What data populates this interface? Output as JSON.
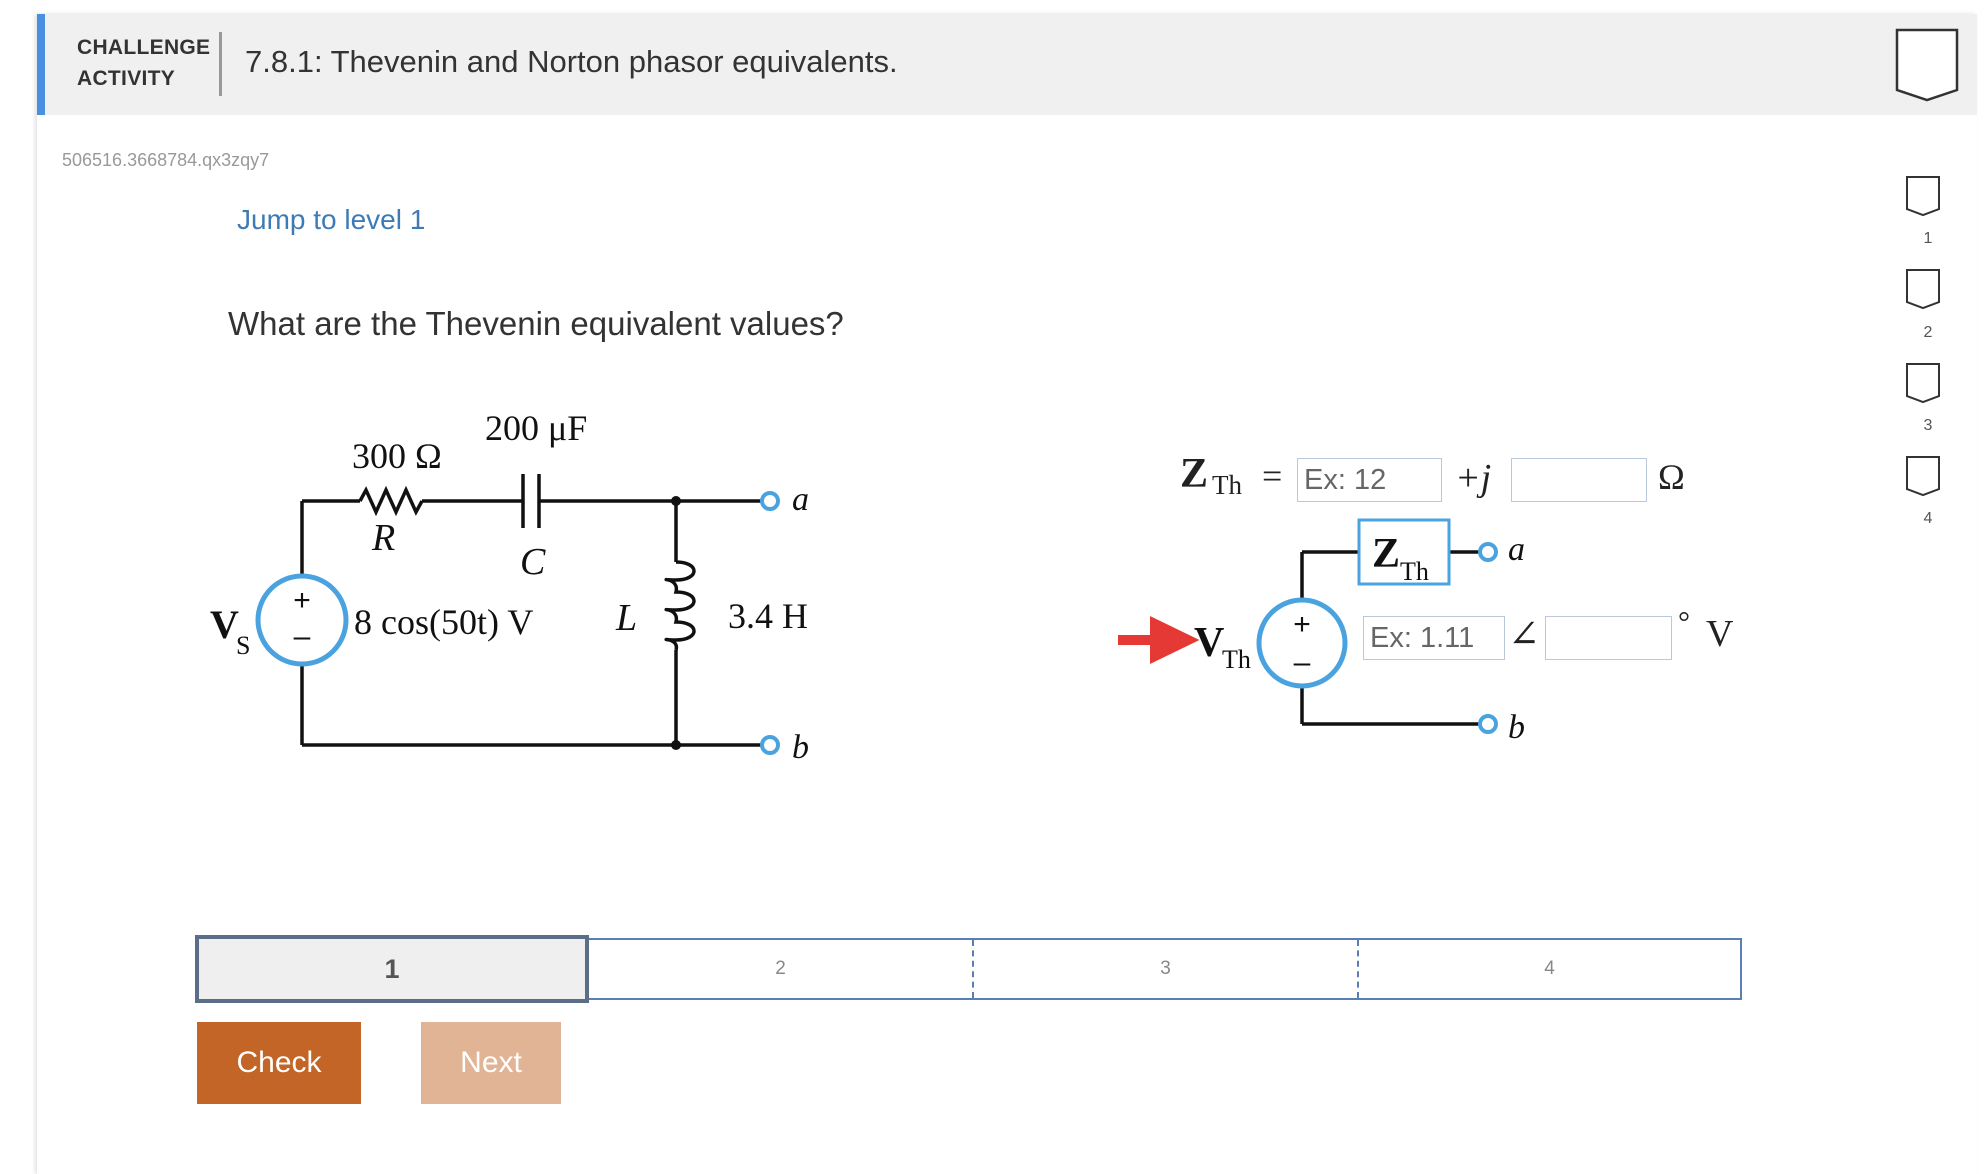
{
  "header": {
    "challenge_line1": "CHALLENGE",
    "challenge_line2": "ACTIVITY",
    "title": "7.8.1: Thevenin and Norton phasor equivalents."
  },
  "activity_id": "506516.3668784.qx3zqy7",
  "jump_link": "Jump to level 1",
  "question": "What are the Thevenin equivalent values?",
  "circuit": {
    "resistor_value": "300 Ω",
    "resistor_label": "R",
    "capacitor_value": "200 μF",
    "capacitor_label": "C",
    "source_label": "V",
    "source_sub": "S",
    "source_expr": "8 cos(50t) V",
    "inductor_label": "L",
    "inductor_value": "3.4 H",
    "terminal_a": "a",
    "terminal_b": "b",
    "plus": "+",
    "minus": "–"
  },
  "thevenin": {
    "z_symbol": "Z",
    "z_sub": "Th",
    "equals": "=",
    "real_placeholder": "Ex: 12",
    "plus_j": "+j",
    "imag_placeholder": "",
    "ohm_unit": "Ω",
    "box_z": "Z",
    "box_sub": "Th",
    "terminal_a": "a",
    "terminal_b": "b",
    "v_symbol": "V",
    "v_sub": "Th",
    "mag_placeholder": "Ex: 1.11",
    "angle_symbol": "∠",
    "angle_placeholder": "",
    "degree_unit": "°",
    "volt_unit": "V",
    "plus": "+",
    "minus": "–"
  },
  "progress": {
    "active": "1",
    "levels": [
      "2",
      "3",
      "4"
    ]
  },
  "buttons": {
    "check": "Check",
    "next": "Next"
  },
  "level_nav": [
    "1",
    "2",
    "3",
    "4"
  ],
  "colors": {
    "accent_blue": "#4a90e2",
    "link_blue": "#3e7bb6",
    "check_orange": "#c26527",
    "next_peach": "#e0b494",
    "arrow_red": "#e53935",
    "source_blue": "#4aa3df"
  }
}
